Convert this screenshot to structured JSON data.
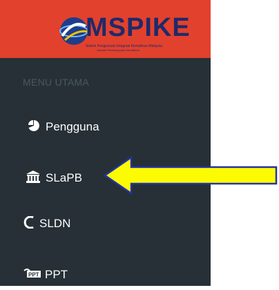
{
  "brand": {
    "title": "MSPIKE",
    "subtitle": "Sistem Pengurusan Integrasi Kemahiran Malaysia",
    "subtitle2": "Jabatan Pembangunan Kemahiran"
  },
  "menu": {
    "header": "MENU UTAMA",
    "items": [
      {
        "label": "Pengguna",
        "icon": "pie-chart-icon"
      },
      {
        "label": "SLaPB",
        "icon": "bank-icon"
      },
      {
        "label": "SLDN",
        "icon": "sldn-logo-icon"
      },
      {
        "label": "PPT",
        "icon": "ppt-logo-icon"
      }
    ]
  },
  "colors": {
    "sidebar_bg": "#263036",
    "brand_bg": "#e2412d",
    "arrow_fill": "#fdfb03",
    "arrow_stroke": "#2233a8"
  }
}
